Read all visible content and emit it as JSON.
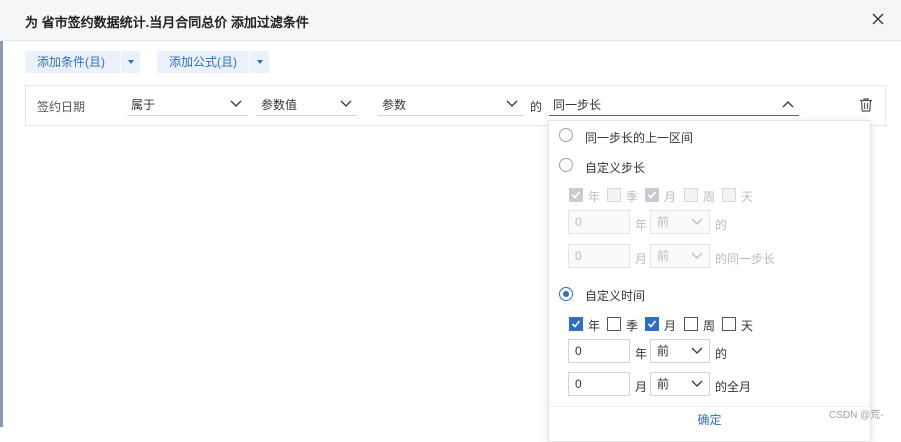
{
  "dialog": {
    "title": "为 省市签约数据统计.当月合同总价 添加过滤条件"
  },
  "toolbar": {
    "add_condition_label": "添加条件(且)",
    "add_formula_label": "添加公式(且)"
  },
  "condition": {
    "field": "签约日期",
    "operator": "属于",
    "value_type": "参数值",
    "param": "参数",
    "of_label": "的",
    "period": "同一步长"
  },
  "period_panel": {
    "option_prev_interval": "同一步长的上一区间",
    "option_custom_step": "自定义步长",
    "option_custom_time": "自定义时间",
    "granularity": {
      "year": "年",
      "quarter": "季",
      "month": "月",
      "week": "周",
      "day": "天"
    },
    "step": {
      "row1_value": "0",
      "row1_unit": "年",
      "row1_dir": "前",
      "row1_suffix": "的",
      "row2_value": "0",
      "row2_unit": "月",
      "row2_dir": "前",
      "row2_suffix": "的同一步长"
    },
    "time": {
      "row1_value": "0",
      "row1_unit": "年",
      "row1_dir": "前",
      "row1_suffix": "的",
      "row2_value": "0",
      "row2_unit": "月",
      "row2_dir": "前",
      "row2_suffix": "的全月"
    },
    "confirm_label": "确定"
  },
  "watermark": "CSDN @荒-",
  "colors": {
    "accent": "#2f6ec6",
    "header_bg": "#f5f6f8"
  }
}
